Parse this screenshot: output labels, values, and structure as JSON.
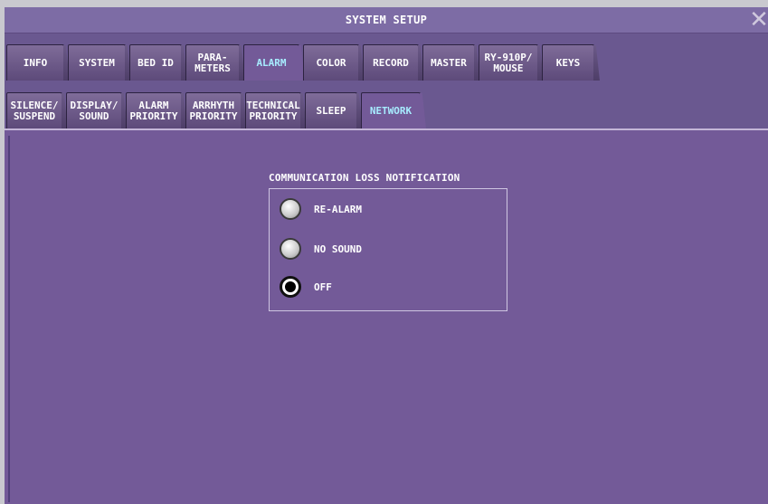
{
  "window": {
    "title": "SYSTEM SETUP"
  },
  "tabs_top": [
    {
      "label": "INFO",
      "active": false
    },
    {
      "label": "SYSTEM",
      "active": false
    },
    {
      "label": "BED ID",
      "active": false
    },
    {
      "label": "PARA-\nMETERS",
      "active": false
    },
    {
      "label": "ALARM",
      "active": true
    },
    {
      "label": "COLOR",
      "active": false
    },
    {
      "label": "RECORD",
      "active": false
    },
    {
      "label": "MASTER",
      "active": false
    },
    {
      "label": "RY-910P/\nMOUSE",
      "active": false
    },
    {
      "label": "KEYS",
      "active": false
    }
  ],
  "tabs_sub": [
    {
      "label": "SILENCE/\nSUSPEND",
      "active": false
    },
    {
      "label": "DISPLAY/\nSOUND",
      "active": false
    },
    {
      "label": "ALARM\nPRIORITY",
      "active": false
    },
    {
      "label": "ARRHYTH\nPRIORITY",
      "active": false
    },
    {
      "label": "TECHNICAL\nPRIORITY",
      "active": false
    },
    {
      "label": "SLEEP",
      "active": false
    },
    {
      "label": "NETWORK",
      "active": true
    }
  ],
  "main": {
    "group_title": "COMMUNICATION LOSS NOTIFICATION",
    "options": [
      {
        "label": "RE-ALARM",
        "selected": false
      },
      {
        "label": "NO SOUND",
        "selected": false
      },
      {
        "label": "OFF",
        "selected": true
      }
    ]
  },
  "icons": {
    "close": "close-icon"
  },
  "colors": {
    "panel": "#735a98",
    "titlebar": "#7d6ca5",
    "active_tab_text": "#a7ecff"
  }
}
